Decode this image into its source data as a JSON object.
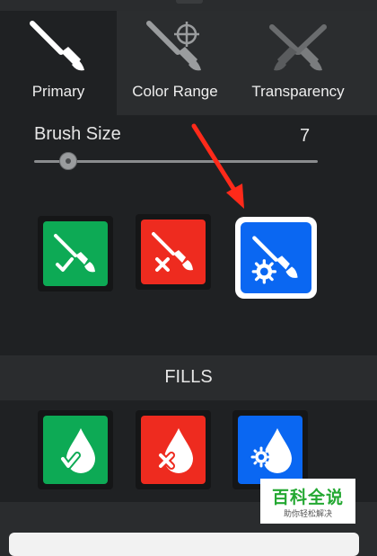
{
  "tabs": [
    {
      "label": "Primary",
      "icon": "paintbrush-icon",
      "active": true
    },
    {
      "label": "Color Range",
      "icon": "paintbrush-target-icon",
      "active": false
    },
    {
      "label": "Transparency",
      "icon": "paintbrush-transparency-icon",
      "active": false
    }
  ],
  "brush": {
    "label": "Brush Size",
    "value": "7",
    "level_fraction": 0.09
  },
  "brush_modes": [
    {
      "name": "add-brush",
      "color": "#0daa55",
      "icon": "brush-check-icon"
    },
    {
      "name": "remove-brush",
      "color": "#ee2b1f",
      "icon": "brush-x-icon"
    },
    {
      "name": "settings-brush",
      "color": "#0a67f2",
      "icon": "brush-gear-icon",
      "selected": true
    }
  ],
  "fills": {
    "label": "FILLS",
    "modes": [
      {
        "name": "add-fill",
        "color": "#0daa55",
        "icon": "drop-check-icon"
      },
      {
        "name": "remove-fill",
        "color": "#ee2b1f",
        "icon": "drop-x-icon"
      },
      {
        "name": "settings-fill",
        "color": "#0a67f2",
        "icon": "drop-gear-icon"
      }
    ]
  },
  "annotation": {
    "arrow_color": "#ff2a1a"
  },
  "watermark": {
    "title": "百科全说",
    "subtitle": "助你轻松解决"
  }
}
